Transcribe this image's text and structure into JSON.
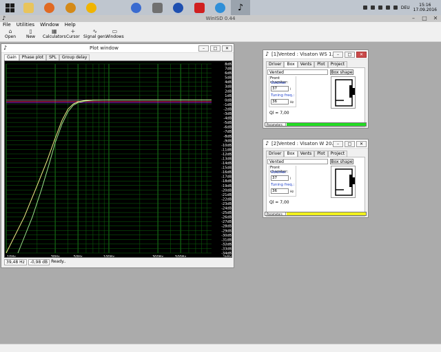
{
  "taskbar": {
    "clock_time": "15:16",
    "clock_date": "17.09.2016",
    "language": "DEU",
    "apps": [
      {
        "icon": "windows-start-icon"
      },
      {
        "icon": "file-explorer-icon"
      },
      {
        "icon": "firefox-icon"
      },
      {
        "icon": "audio-app-icon"
      },
      {
        "icon": "triangle-app-icon"
      },
      {
        "icon": "settings-gear-icon"
      },
      {
        "icon": "tools-icon"
      },
      {
        "icon": "lock-icon"
      },
      {
        "icon": "red-app-icon"
      },
      {
        "icon": "disk-app-icon"
      },
      {
        "icon": "winisd-icon"
      }
    ]
  },
  "app": {
    "title": "WinISD 0.44",
    "menu": [
      "File",
      "Utilities",
      "Window",
      "Help"
    ],
    "toolbar": [
      {
        "label": "Open",
        "icon": "open-folder-icon"
      },
      {
        "label": "New",
        "icon": "new-document-icon"
      },
      {
        "label": "Calculators",
        "icon": "calculator-icon"
      },
      {
        "label": "Cursor",
        "icon": "cursor-crosshair-icon"
      },
      {
        "label": "Signal gen.",
        "icon": "signal-generator-icon"
      },
      {
        "label": "Windows",
        "icon": "windows-icon"
      }
    ]
  },
  "plot_window": {
    "title": "Plot window",
    "tabs": [
      "Gain",
      "Phase plot",
      "SPL",
      "Group delay"
    ],
    "status": {
      "freq": "39,48 Hz",
      "level": "-0,98 dB",
      "message": "Ready.."
    }
  },
  "chart_data": {
    "type": "line",
    "title": "",
    "xlabel": "",
    "ylabel": "",
    "x_scale": "log",
    "xlim": [
      10,
      1000
    ],
    "ylim": [
      -34,
      8
    ],
    "x_tick_labels": [
      "10Hz",
      "30Hz",
      "50Hz",
      "100Hz",
      "300Hz",
      "500Hz",
      "1kHz"
    ],
    "x_tick_values": [
      10,
      30,
      50,
      100,
      300,
      500,
      1000
    ],
    "y_tick_labels": [
      "8dB",
      "7dB",
      "6dB",
      "5dB",
      "4dB",
      "3dB",
      "2dB",
      "1dB",
      "0dB",
      "-1dB",
      "-2dB",
      "-3dB",
      "-4dB",
      "-5dB",
      "-6dB",
      "-7dB",
      "-8dB",
      "-9dB",
      "-10dB",
      "-11dB",
      "-12dB",
      "-13dB",
      "-14dB",
      "-15dB",
      "-16dB",
      "-17dB",
      "-18dB",
      "-19dB",
      "-20dB",
      "-21dB",
      "-22dB",
      "-23dB",
      "-24dB",
      "-25dB",
      "-26dB",
      "-27dB",
      "-28dB",
      "-29dB",
      "-30dB",
      "-31dB",
      "-32dB",
      "-33dB",
      "-34dB"
    ],
    "grid": true,
    "colors": {
      "background": "#000000",
      "grid": "#0c6a0c",
      "major_grid": "#1f9a1f",
      "text": "#ffffff",
      "zero_line": "#b0b0b0",
      "ref_line": "#ff2a6a",
      "ref_line2": "#9b2bd8"
    },
    "reference_lines": [
      {
        "y": 0,
        "color": "#b0b0b0"
      },
      {
        "y": -0.3,
        "color": "#ff2a6a"
      },
      {
        "y": -0.6,
        "color": "#9b2bd8"
      }
    ],
    "series": [
      {
        "color": "#f6f08a",
        "x": [
          10,
          15,
          20,
          25,
          30,
          35,
          40,
          45,
          50,
          60,
          70,
          100,
          1000
        ],
        "y": [
          -34,
          -26,
          -19,
          -13.5,
          -8.5,
          -4.5,
          -2,
          -0.9,
          -0.4,
          -0.1,
          0,
          0,
          0
        ]
      },
      {
        "color": "#9be08b",
        "x": [
          13,
          18,
          22,
          26,
          30,
          35,
          40,
          45,
          50,
          60,
          70,
          100,
          1000
        ],
        "y": [
          -34,
          -26,
          -20,
          -14.5,
          -9.5,
          -5.3,
          -2.6,
          -1.2,
          -0.6,
          -0.2,
          -0.05,
          0,
          0
        ]
      }
    ]
  },
  "box1": {
    "title": "[1]Vented : Visaton WS 1...",
    "tabs": [
      "Driver",
      "Box",
      "Vents",
      "Plot",
      "Project"
    ],
    "box_type": "Vented",
    "box_shape_button": "Box shape",
    "front_chamber_label": "Front chamber:",
    "volume_label": "Volume:",
    "volume_value": "37",
    "volume_unit": "l",
    "tuning_label": "Tuning freq.:",
    "tuning_value": "36",
    "tuning_unit": "Hz",
    "ql": "Ql = 7,00",
    "param_label": "Parameters",
    "color": "#22dd22"
  },
  "box2": {
    "title": "[2]Vented : Visaton W 20...",
    "tabs": [
      "Driver",
      "Box",
      "Vents",
      "Plot",
      "Project"
    ],
    "box_type": "Vented",
    "box_shape_button": "Box shape",
    "front_chamber_label": "Front chamber:",
    "volume_label": "Volume:",
    "volume_value": "37",
    "volume_unit": "l",
    "tuning_label": "Tuning freq.:",
    "tuning_value": "36",
    "tuning_unit": "Hz",
    "ql": "Ql = 7,00",
    "param_label": "Parameters",
    "color": "#f2f21e"
  }
}
